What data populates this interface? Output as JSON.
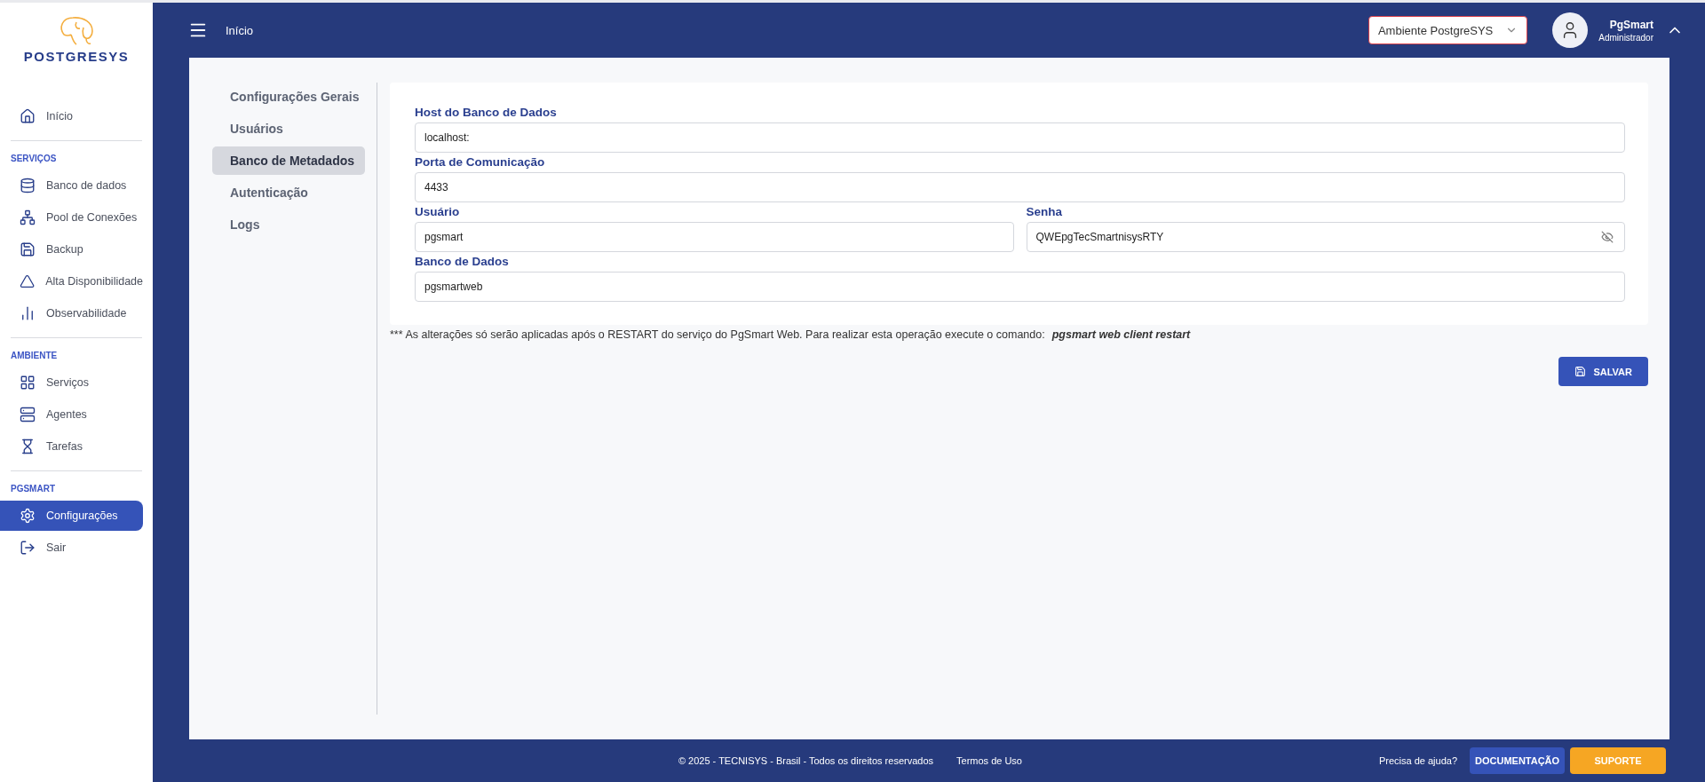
{
  "logo": {
    "text": "POSTGRESYS"
  },
  "sidebar": {
    "sections": [
      {
        "items": [
          {
            "label": "Início",
            "selected": false
          }
        ]
      },
      {
        "title": "SERVIÇOS",
        "items": [
          {
            "label": "Banco de dados",
            "selected": false
          },
          {
            "label": "Pool de Conexões",
            "selected": false
          },
          {
            "label": "Backup",
            "selected": false
          },
          {
            "label": "Alta Disponibilidade",
            "selected": false
          },
          {
            "label": "Observabilidade",
            "selected": false
          }
        ]
      },
      {
        "title": "AMBIENTE",
        "items": [
          {
            "label": "Serviços",
            "selected": false
          },
          {
            "label": "Agentes",
            "selected": false
          },
          {
            "label": "Tarefas",
            "selected": false
          }
        ]
      },
      {
        "title": "PGSMART",
        "items": [
          {
            "label": "Configurações",
            "selected": true
          },
          {
            "label": "Sair",
            "selected": false
          }
        ]
      }
    ]
  },
  "header": {
    "breadcrumb": "Início",
    "environment": "Ambiente PostgreSYS",
    "user": {
      "name": "PgSmart",
      "role": "Administrador"
    }
  },
  "settings_menu": [
    {
      "label": "Configurações Gerais",
      "selected": false
    },
    {
      "label": "Usuários",
      "selected": false
    },
    {
      "label": "Banco de Metadados",
      "selected": true
    },
    {
      "label": "Autenticação",
      "selected": false
    },
    {
      "label": "Logs",
      "selected": false
    }
  ],
  "form": {
    "rows": [
      [
        {
          "label": "Host do Banco de Dados",
          "value": "localhost:"
        }
      ],
      [
        {
          "label": "Porta de Comunicação",
          "value": "4433"
        }
      ],
      [
        {
          "label": "Usuário",
          "value": "pgsmart"
        },
        {
          "label": "Senha",
          "value": "QWEpgTecSmartnisysRTY",
          "kind": "password"
        }
      ],
      [
        {
          "label": "Banco de Dados",
          "value": "pgsmartweb"
        }
      ]
    ]
  },
  "note": {
    "text": "*** As alterações só serão aplicadas após o RESTART do serviço do PgSmart Web. Para realizar esta operação execute o comando:",
    "command": "pgsmart web client restart"
  },
  "save_button": "SALVAR",
  "footer": {
    "copyright": "© 2025 - TECNISYS - Brasil - Todos os direitos reservados",
    "terms": "Termos de Uso",
    "help": "Precisa de ajuda?",
    "docs_button": "DOCUMENTAÇÃO",
    "support_button": "SUPORTE"
  }
}
